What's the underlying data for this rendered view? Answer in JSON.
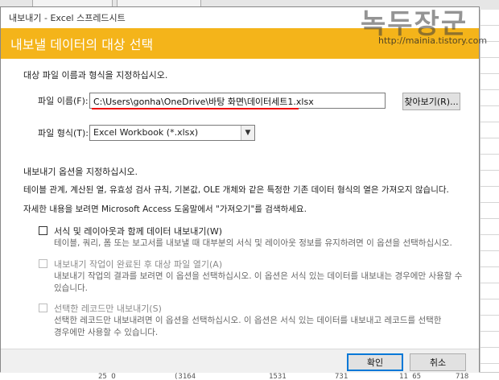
{
  "background": {
    "bottom_cells": [
      "25 O",
      "(3164",
      "1531",
      "731",
      "11 65",
      "718"
    ]
  },
  "watermark": {
    "title": "녹두장군",
    "url": "http://mainia.tistory.com"
  },
  "dialog": {
    "title": "내보내기 - Excel 스프레드시트",
    "heading": "내보낼 데이터의 대상 선택",
    "instruction": "대상 파일 이름과 형식을 지정하십시오.",
    "file_label": "파일 이름(F):",
    "file_value": "C:\\Users\\gonha\\OneDrive\\바탕 화면\\데이터세트1.xlsx",
    "browse_label": "찾아보기(R)...",
    "format_label": "파일 형식(T):",
    "format_value": "Excel Workbook (*.xlsx)",
    "options_heading": "내보내기 옵션을 지정하십시오.",
    "options_info": "테이블 관계, 계산된 열, 유효성 검사 규칙, 기본값, OLE 개체와 같은 특정한 기존 데이터 형식의 열은 가져오지 않습니다.",
    "options_help": "자세한 내용을 보려면 Microsoft Access 도움말에서 \"가져오기\"를 검색하세요.",
    "options": [
      {
        "label": "서식 및 레이아웃과 함께 데이터 내보내기(W)",
        "desc1": "테이블, 쿼리, 폼 또는 보고서를 내보낼 때 대부분의 서식 및 레이아웃 정보를 유지하려면 이 옵션을 선택하십시오.",
        "desc2": ""
      },
      {
        "label": "내보내기 작업이 완료된 후 대상 파일 열기(A)",
        "desc1": "내보내기 작업의 결과를 보려면 이 옵션을 선택하십시오. 이 옵션은 서식 있는 데이터를 내보내는 경우에만 사용할 수",
        "desc2": "있습니다."
      },
      {
        "label": "선택한 레코드만 내보내기(S)",
        "desc1": "선택한 레코드만 내보내려면 이 옵션을 선택하십시오. 이 옵션은 서식 있는 데이터를 내보내고 레코드를 선택한",
        "desc2": "경우에만 사용할 수 있습니다."
      }
    ],
    "ok_label": "확인",
    "cancel_label": "취소"
  },
  "colors": {
    "banner": "#f4b41a",
    "highlight_underline": "#e11111",
    "default_button_border": "#0078d7"
  },
  "icons": {
    "dropdown": "chevron-down-icon"
  }
}
